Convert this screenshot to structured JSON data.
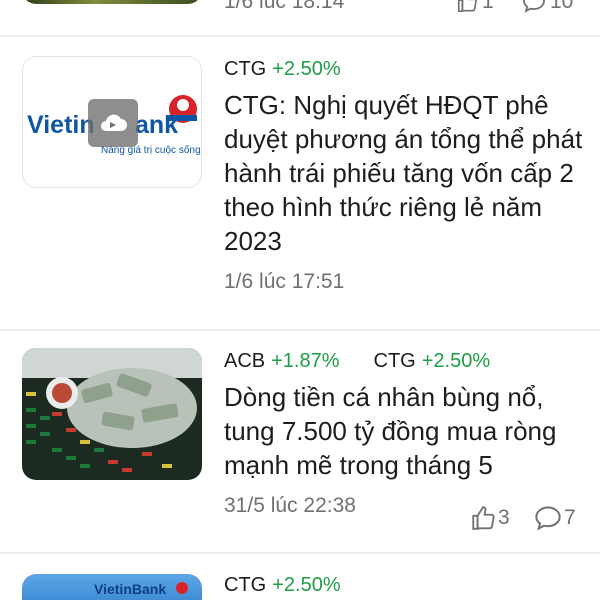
{
  "previous": {
    "time": "1/6 lúc 18:14",
    "likes": "1",
    "comments": "10"
  },
  "articles": [
    {
      "tags": [
        {
          "code": "CTG",
          "change": "+2.50%"
        }
      ],
      "thumbnail": {
        "brand": "VietinBank",
        "slogan": "Nâng giá trị cuộc sống",
        "video_icon": "cloud-play-icon"
      },
      "headline": "CTG: Nghị quyết HĐQT phê duyệt phương án tổng thể phát hành trái phiếu tăng vốn cấp 2 theo hình thức riêng lẻ năm 2023",
      "time": "1/6 lúc 17:51"
    },
    {
      "tags": [
        {
          "code": "ACB",
          "change": "+1.87%"
        },
        {
          "code": "CTG",
          "change": "+2.50%"
        }
      ],
      "thumbnail": {
        "icon": "money-stock-board-image"
      },
      "headline": "Dòng tiền cá nhân bùng nổ, tung 7.500 tỷ đồng mua ròng mạnh mẽ trong tháng 5",
      "time": "31/5 lúc 22:38",
      "likes": "3",
      "comments": "7"
    },
    {
      "tags": [
        {
          "code": "CTG",
          "change": "+2.50%"
        }
      ],
      "thumbnail": {
        "brand": "VietinBank"
      }
    }
  ],
  "colors": {
    "positive": "#1e9e45",
    "muted": "#707075",
    "brand_blue": "#0e56a4",
    "brand_red": "#d8232a"
  }
}
